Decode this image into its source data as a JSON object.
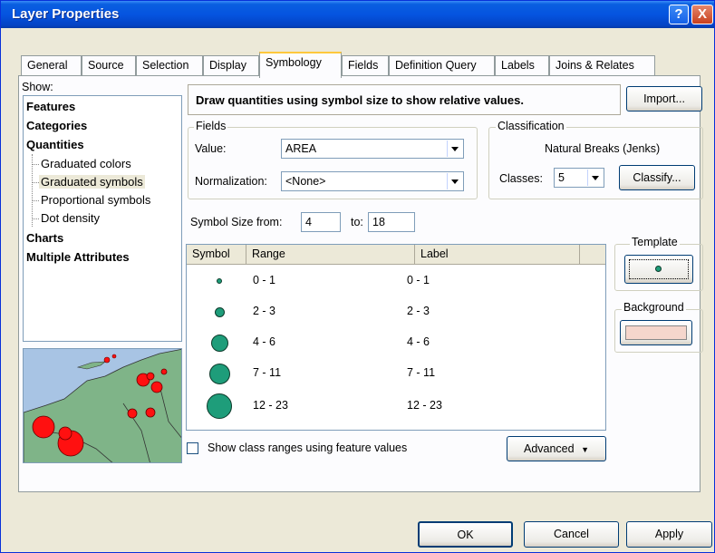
{
  "window": {
    "title": "Layer Properties",
    "help_label": "?",
    "close_label": "X"
  },
  "tabs": [
    {
      "label": "General"
    },
    {
      "label": "Source"
    },
    {
      "label": "Selection"
    },
    {
      "label": "Display"
    },
    {
      "label": "Symbology"
    },
    {
      "label": "Fields"
    },
    {
      "label": "Definition Query"
    },
    {
      "label": "Labels"
    },
    {
      "label": "Joins & Relates"
    }
  ],
  "show": {
    "label": "Show:",
    "items": [
      {
        "label": "Features"
      },
      {
        "label": "Categories"
      },
      {
        "label": "Quantities"
      },
      {
        "label": "Graduated colors"
      },
      {
        "label": "Graduated symbols"
      },
      {
        "label": "Proportional symbols"
      },
      {
        "label": "Dot density"
      },
      {
        "label": "Charts"
      },
      {
        "label": "Multiple Attributes"
      }
    ]
  },
  "description": "Draw quantities using symbol size to show relative values.",
  "import_label": "Import...",
  "fields": {
    "title": "Fields",
    "value_label": "Value:",
    "value": "AREA",
    "normalization_label": "Normalization:",
    "normalization": "<None>"
  },
  "classification": {
    "title": "Classification",
    "method": "Natural Breaks (Jenks)",
    "classes_label": "Classes:",
    "classes": "5",
    "classify_label": "Classify..."
  },
  "symbol_size": {
    "from_label": "Symbol Size from:",
    "from": "4",
    "to_label": "to:",
    "to": "18"
  },
  "table": {
    "headers": [
      "Symbol",
      "Range",
      "Label"
    ],
    "rows": [
      {
        "range": "0 - 1",
        "label": "0 - 1",
        "size": 6
      },
      {
        "range": "2 - 3",
        "label": "2 - 3",
        "size": 11
      },
      {
        "range": "4 - 6",
        "label": "4 - 6",
        "size": 19
      },
      {
        "range": "7 - 11",
        "label": "7 - 11",
        "size": 23
      },
      {
        "range": "12 - 23",
        "label": "12 - 23",
        "size": 28
      }
    ]
  },
  "template": {
    "title": "Template"
  },
  "background": {
    "title": "Background",
    "color": "#f5d6cc"
  },
  "symbol_color": "#1e9d7a",
  "show_ranges_label": "Show class ranges using feature values",
  "advanced_label": "Advanced",
  "footer": {
    "ok_label": "OK",
    "cancel_label": "Cancel",
    "apply_label": "Apply"
  }
}
